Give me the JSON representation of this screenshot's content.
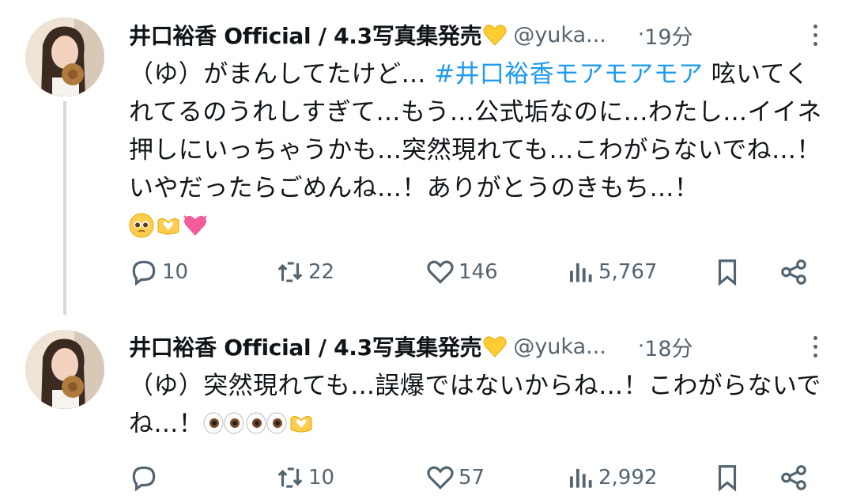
{
  "tweets": [
    {
      "author_name": "井口裕香 Official / 4.3写真集発売",
      "author_emoji": "yellow-heart-emoji",
      "handle": "@yuka...",
      "dot": "·",
      "time": "19分",
      "text_before": "（ゆ）がまんしてたけど… ",
      "hashtag": "#井口裕香モアモアモア",
      "text_after": " 呟いてくれてるのうれしすぎて…もう…公式垢なのに…わたし…イイネ押しにいっちゃうかも…突然現れても…こわがらないでね…！いやだったらごめんね…！ありがとうのきもち…！",
      "emojis": [
        "pleading-face-emoji",
        "heart-hands-emoji",
        "growing-heart-emoji"
      ],
      "actions": {
        "replies": "10",
        "reposts": "22",
        "likes": "146",
        "views": "5,767"
      }
    },
    {
      "author_name": "井口裕香 Official / 4.3写真集発売",
      "author_emoji": "yellow-heart-emoji",
      "handle": "@yuka...",
      "dot": "·",
      "time": "18分",
      "text_before": "（ゆ）突然現れても…誤爆ではないからね…！こわがらないでね…！",
      "hashtag": "",
      "text_after": "",
      "emojis": [
        "eyes-emoji",
        "eyes-emoji",
        "heart-hands-emoji"
      ],
      "actions": {
        "replies": "",
        "reposts": "10",
        "likes": "57",
        "views": "2,992"
      }
    }
  ],
  "colors": {
    "hashtag": "#1d9bf0",
    "secondary_text": "#536471",
    "thread_line": "#cfd9de",
    "growing_heart": "#f25c9a",
    "heart_emoji": "#ffcc33"
  }
}
